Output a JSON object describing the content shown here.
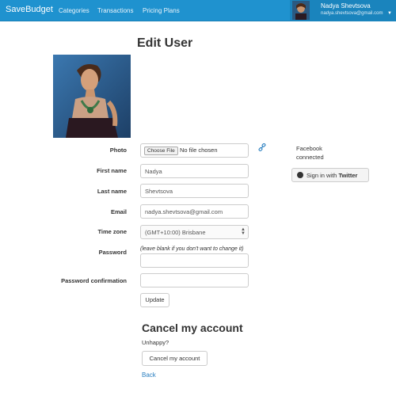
{
  "navbar": {
    "brand": "SaveBudget",
    "links": [
      "Categories",
      "Transactions",
      "Pricing Plans"
    ],
    "user_name": "Nadya Shevtsova",
    "user_email": "nadya.shevtsova@gmail.com"
  },
  "page": {
    "title": "Edit User"
  },
  "form": {
    "photo_label": "Photo",
    "file_button": "Choose File",
    "file_status": "No file chosen",
    "first_name_label": "First name",
    "first_name_value": "Nadya",
    "last_name_label": "Last name",
    "last_name_value": "Shevtsova",
    "email_label": "Email",
    "email_value": "nadya.shevtsova@gmail.com",
    "timezone_label": "Time zone",
    "timezone_value": "(GMT+10:00) Brisbane",
    "password_label": "Password",
    "password_hint": "(leave blank if you don't want to change it)",
    "password_confirm_label": "Password confirmation",
    "update_button": "Update"
  },
  "social": {
    "facebook_line1": "Facebook",
    "facebook_line2": "connected",
    "twitter_prefix": "Sign in with ",
    "twitter_bold": "Twitter"
  },
  "cancel": {
    "heading": "Cancel my account",
    "text": "Unhappy?",
    "button": "Cancel my account",
    "back_link": "Back"
  },
  "colors": {
    "navbar": "#1f92cf",
    "link": "#2a7fc0"
  },
  "icons": [
    "chevron-down-icon",
    "link-icon",
    "twitter-icon",
    "select-arrows-icon"
  ]
}
